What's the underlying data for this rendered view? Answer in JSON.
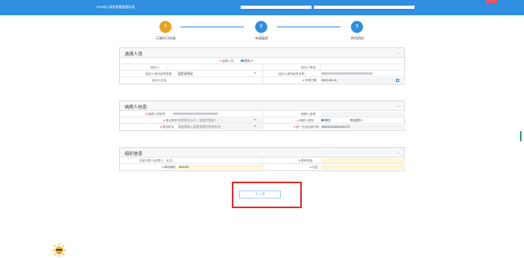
{
  "header": {
    "app_title": "TGH纳入政府智能税管标准"
  },
  "steps": [
    {
      "number": "1",
      "label": "行政许可申请",
      "state": "current",
      "color": "#e8a321"
    },
    {
      "number": "2",
      "label": "申请填表",
      "state": "pending",
      "color": "#2f8ee0"
    },
    {
      "number": "3",
      "label": "附列资料",
      "state": "pending",
      "color": "#2f8ee0"
    }
  ],
  "section_applicant": {
    "title": "选择人员",
    "role_label": "选择人员",
    "role_option_agent": "经办人",
    "agent_name_label": "经办人",
    "agent_name_value": "、",
    "agent_phone_label": "经办人电话",
    "id_type_label": "经办人身份证件种类",
    "id_type_value": "居民身份证",
    "id_number_label": "经办人身份证件号码",
    "address_label": "经办人住址",
    "apply_date_label": "申请日期",
    "apply_date_value": "2020-05-11"
  },
  "section_taxpayer": {
    "title": "纳税人信息",
    "taxpayer_id_label": "纳税人识别号",
    "taxpayer_name_label": "纳税人名称",
    "reg_type_label": "登记类型",
    "reg_type_value": "有限责任公司（非国控国有）",
    "taxpayer_type_label": "纳税人类型",
    "taxpayer_type_opt1": "单位",
    "taxpayer_type_opt2": "自然人",
    "authority_label": "税务机关",
    "authority_placeholder": "请选择纳入监督管理的税务机关",
    "credit_code_label": "统一社会信用代码",
    "credit_code_value": "15002202005110170"
  },
  "section_org": {
    "title": "组织信息",
    "legal_rep_label": "法定代表人(负责人、业主)",
    "contact_phone_label": "联系电话",
    "postcode_label": "邮政编码",
    "postcode_value": "400000",
    "address_label": "住址"
  },
  "actions": {
    "next_label": "下一步"
  }
}
